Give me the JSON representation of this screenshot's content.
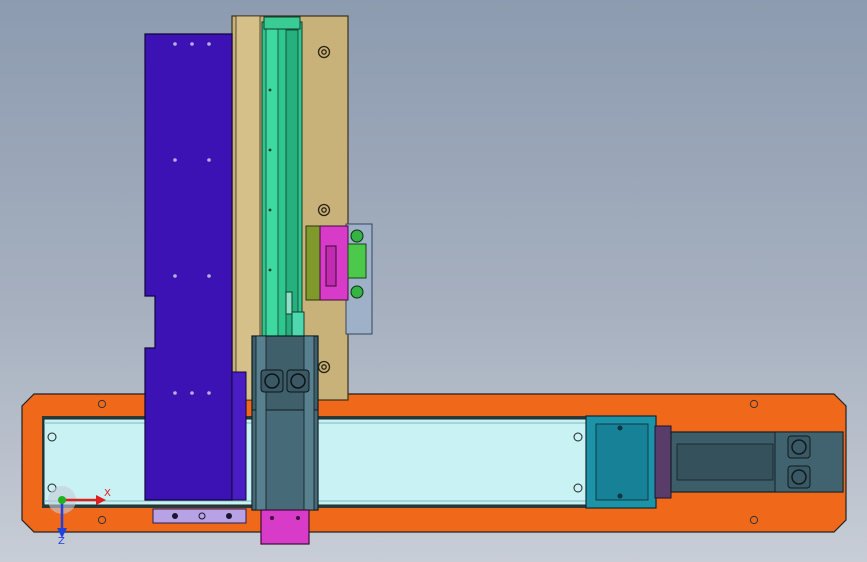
{
  "colors": {
    "background_top": "#8d9bb0",
    "background_bottom": "#c8cdd6",
    "base_plate": "#f0681a",
    "rail_glass": "#c9f2f4",
    "vertical_plate": "#c9b27a",
    "side_panel": "#3c12b4",
    "slider_carriage": "#3f5f6b",
    "motor_block": "#1d93a8",
    "gripper_magenta": "#d93bc9",
    "sensor_green": "#4cc84a",
    "guide_rail": "#2fc68f",
    "axis_x": "#e02020",
    "axis_y": "#20b020",
    "axis_z": "#2040e0"
  },
  "icons": {
    "triad": "coordinate-triad-icon"
  },
  "triad": {
    "x_label": "X",
    "z_label": "Z"
  }
}
